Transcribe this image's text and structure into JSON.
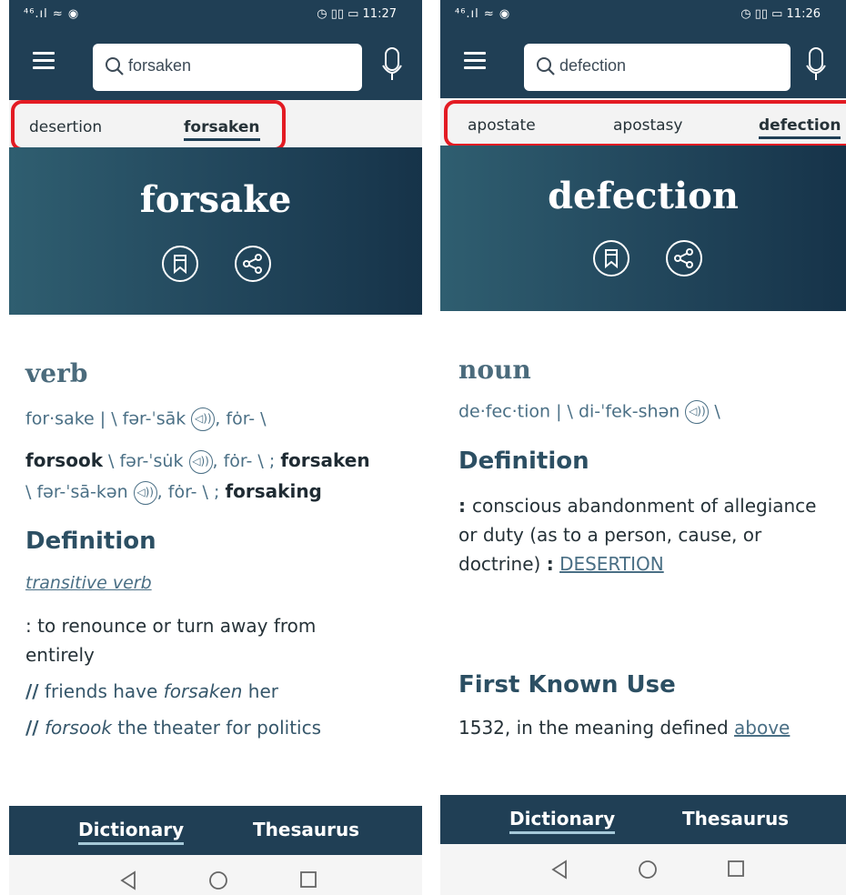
{
  "left": {
    "status": {
      "signal": "⁴⁶.ıl ≈ ◉",
      "right": "◷ ▯▯ ▭ 11:27"
    },
    "search": {
      "query": "forsaken"
    },
    "tabs": [
      "desertion",
      "forsaken"
    ],
    "active_tab": "forsaken",
    "headword": "forsake",
    "part_of_speech": "verb",
    "pronunciation": "for·sake  |  \\ fər-ˈsāk",
    "pron_alt": ", fȯr- \\",
    "forms": {
      "past": "forsook",
      "past_pron": " \\ fər-ˈsu̇k ",
      "past_alt": ", fȯr- \\ ; ",
      "pp": "forsaken",
      "pp_pron": "\\ fər-ˈsā-kən ",
      "pp_alt": ", fȯr- \\ ; ",
      "prog": "forsaking"
    },
    "definition_header": "Definition",
    "label": "transitive verb",
    "definition": ": to renounce or turn away from entirely",
    "examples": [
      {
        "mark": "//",
        "pre": " friends have ",
        "em": "forsaken",
        "post": " her"
      },
      {
        "mark": "//",
        "pre": " ",
        "em": "forsook",
        "post": " the theater for politics"
      }
    ],
    "bottom_tabs": [
      "Dictionary",
      "Thesaurus"
    ]
  },
  "right": {
    "status": {
      "signal": "⁴⁶.ıl ≈ ◉",
      "right": "◷ ▯▯ ▭ 11:26"
    },
    "search": {
      "query": "defection"
    },
    "tabs": [
      "apostate",
      "apostasy",
      "defection"
    ],
    "active_tab": "defection",
    "headword": "defection",
    "part_of_speech": "noun",
    "pronunciation": "de·fec·tion  |  \\ di-ˈfek-shən",
    "pron_tail": " \\",
    "definition_header": "Definition",
    "definition": "conscious abandonment of allegiance or duty (as to a person, cause, or doctrine)",
    "definition_xref": "DESERTION",
    "first_use_header": "First Known Use",
    "first_use_text": "1532, in the meaning defined ",
    "first_use_link": "above",
    "bottom_tabs": [
      "Dictionary",
      "Thesaurus"
    ]
  },
  "audio_icon_glyph": "◁))",
  "colors": {
    "brand_navy": "#203f55",
    "accent_teal": "#4a6f85",
    "highlight_red": "#e31b23"
  }
}
